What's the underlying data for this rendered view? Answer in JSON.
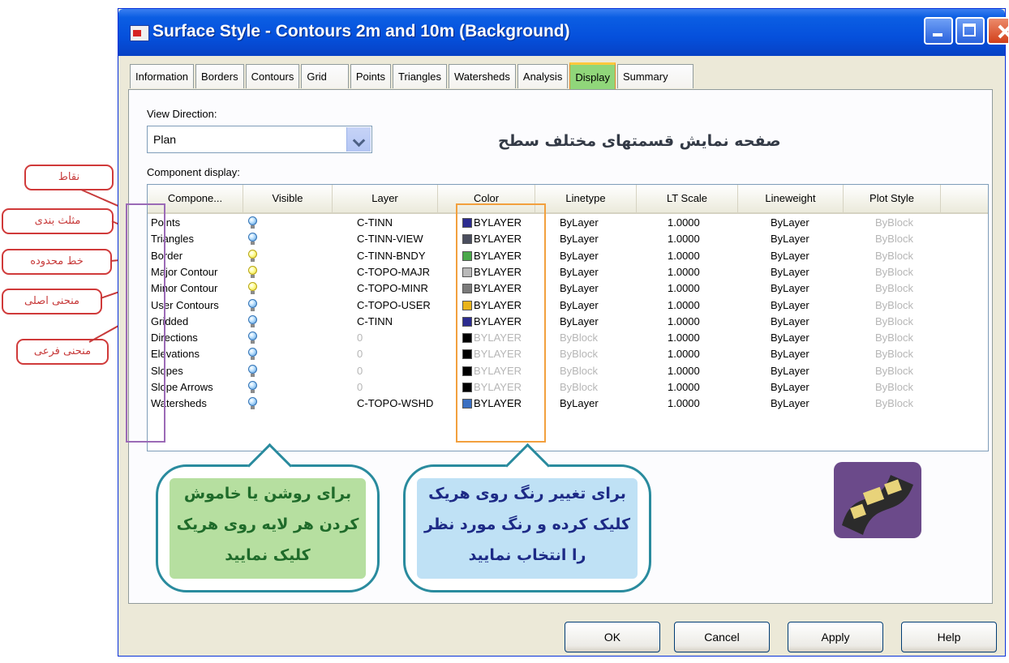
{
  "window": {
    "title": "Surface Style - Contours 2m and 10m (Background)"
  },
  "tabs": [
    {
      "label": "Information"
    },
    {
      "label": "Borders"
    },
    {
      "label": "Contours"
    },
    {
      "label": "Grid"
    },
    {
      "label": "Points"
    },
    {
      "label": "Triangles"
    },
    {
      "label": "Watersheds"
    },
    {
      "label": "Analysis"
    },
    {
      "label": "Display",
      "active": true
    },
    {
      "label": "Summary"
    }
  ],
  "view_direction": {
    "label": "View Direction:",
    "value": "Plan"
  },
  "page_caption_fa": "صفحه نمایش قسمتهای مختلف سطح",
  "component_display": {
    "label": "Component display:",
    "columns": [
      "Compone...",
      "Visible",
      "Layer",
      "Color",
      "Linetype",
      "LT Scale",
      "Lineweight",
      "Plot Style"
    ],
    "rows": [
      {
        "component": "Points",
        "visible": "off",
        "layer": "C-TINN",
        "color": "BYLAYER",
        "swatch": "#2b2b8f",
        "linetype": "ByLayer",
        "lt_scale": "1.0000",
        "lineweight": "ByLayer",
        "plot_style": "ByBlock",
        "inherited": false
      },
      {
        "component": "Triangles",
        "visible": "off",
        "layer": "C-TINN-VIEW",
        "color": "BYLAYER",
        "swatch": "#4a4e5e",
        "linetype": "ByLayer",
        "lt_scale": "1.0000",
        "lineweight": "ByLayer",
        "plot_style": "ByBlock",
        "inherited": false
      },
      {
        "component": "Border",
        "visible": "on",
        "layer": "C-TINN-BNDY",
        "color": "BYLAYER",
        "swatch": "#4aa84a",
        "linetype": "ByLayer",
        "lt_scale": "1.0000",
        "lineweight": "ByLayer",
        "plot_style": "ByBlock",
        "inherited": false
      },
      {
        "component": "Major Contour",
        "visible": "on",
        "layer": "C-TOPO-MAJR",
        "color": "BYLAYER",
        "swatch": "#b9b9b9",
        "linetype": "ByLayer",
        "lt_scale": "1.0000",
        "lineweight": "ByLayer",
        "plot_style": "ByBlock",
        "inherited": false
      },
      {
        "component": "Minor Contour",
        "visible": "on",
        "layer": "C-TOPO-MINR",
        "color": "BYLAYER",
        "swatch": "#7a7a7a",
        "linetype": "ByLayer",
        "lt_scale": "1.0000",
        "lineweight": "ByLayer",
        "plot_style": "ByBlock",
        "inherited": false
      },
      {
        "component": "User Contours",
        "visible": "off",
        "layer": "C-TOPO-USER",
        "color": "BYLAYER",
        "swatch": "#e9b31a",
        "linetype": "ByLayer",
        "lt_scale": "1.0000",
        "lineweight": "ByLayer",
        "plot_style": "ByBlock",
        "inherited": false
      },
      {
        "component": "Gridded",
        "visible": "off",
        "layer": "C-TINN",
        "color": "BYLAYER",
        "swatch": "#2b2b8f",
        "linetype": "ByLayer",
        "lt_scale": "1.0000",
        "lineweight": "ByLayer",
        "plot_style": "ByBlock",
        "inherited": false
      },
      {
        "component": "Directions",
        "visible": "off",
        "layer": "0",
        "color": "BYLAYER",
        "swatch": "#000000",
        "linetype": "ByBlock",
        "lt_scale": "1.0000",
        "lineweight": "ByLayer",
        "plot_style": "ByBlock",
        "inherited": true
      },
      {
        "component": "Elevations",
        "visible": "off",
        "layer": "0",
        "color": "BYLAYER",
        "swatch": "#000000",
        "linetype": "ByBlock",
        "lt_scale": "1.0000",
        "lineweight": "ByLayer",
        "plot_style": "ByBlock",
        "inherited": true
      },
      {
        "component": "Slopes",
        "visible": "off",
        "layer": "0",
        "color": "BYLAYER",
        "swatch": "#000000",
        "linetype": "ByBlock",
        "lt_scale": "1.0000",
        "lineweight": "ByLayer",
        "plot_style": "ByBlock",
        "inherited": true
      },
      {
        "component": "Slope Arrows",
        "visible": "off",
        "layer": "0",
        "color": "BYLAYER",
        "swatch": "#000000",
        "linetype": "ByBlock",
        "lt_scale": "1.0000",
        "lineweight": "ByLayer",
        "plot_style": "ByBlock",
        "inherited": true
      },
      {
        "component": "Watersheds",
        "visible": "off",
        "layer": "C-TOPO-WSHD",
        "color": "BYLAYER",
        "swatch": "#3a6fc2",
        "linetype": "ByLayer",
        "lt_scale": "1.0000",
        "lineweight": "ByLayer",
        "plot_style": "ByBlock",
        "inherited": false
      }
    ]
  },
  "annotations": {
    "visible_bubble": [
      "برای روشن یا خاموش",
      "کردن هر لایه روی هریک",
      "کلیک نمایید"
    ],
    "color_bubble": [
      "برای تغییر رنگ روی هریک",
      "کلیک کرده و رنگ مورد نظر",
      "را انتخاب نمایید"
    ],
    "left_callouts": [
      "نقاط",
      "مثلث بندی",
      "خط محدوده",
      "منحنی اصلی",
      "منحنی فرعی"
    ]
  },
  "buttons": {
    "ok": "OK",
    "cancel": "Cancel",
    "apply": "Apply",
    "help": "Help"
  },
  "colors": {
    "title_bar": "#0550dc",
    "active_tab": "#90d67a",
    "visible_highlight": "#9b6ab6",
    "color_highlight": "#f2a03e",
    "callout": "#d03a3a",
    "bubble_border": "#2a8b9e",
    "bubble_green": "#b6dfa0",
    "bubble_blue": "#bfe1f5"
  }
}
